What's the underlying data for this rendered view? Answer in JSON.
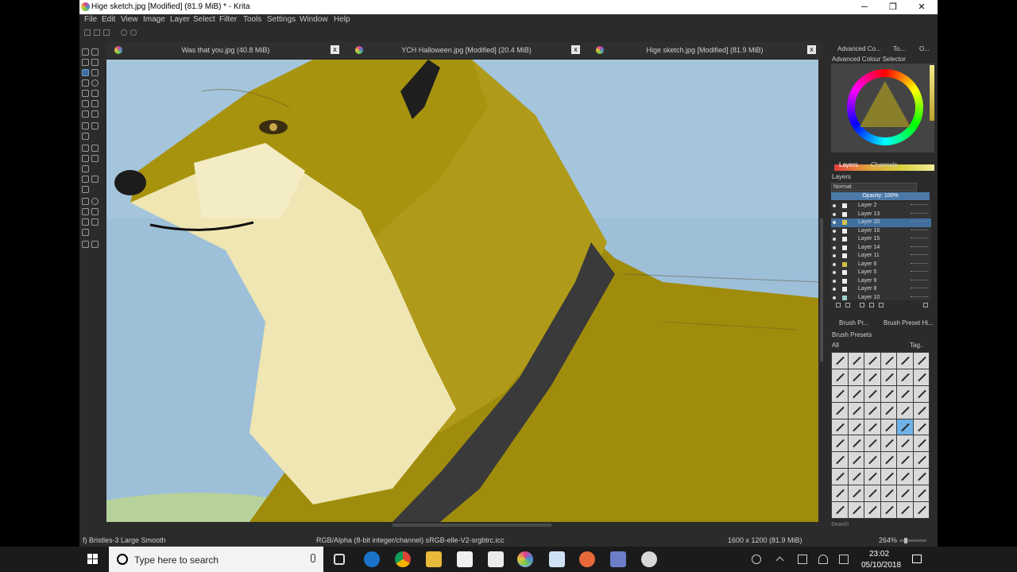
{
  "window": {
    "title": "Hige sketch.jpg [Modified]  (81.9 MiB) * - Krita",
    "buttons": {
      "minimize": "─",
      "maximize": "❐",
      "close": "✕"
    }
  },
  "menu": [
    "File",
    "Edit",
    "View",
    "Image",
    "Layer",
    "Select",
    "Filter",
    "Tools",
    "Settings",
    "Window",
    "Help"
  ],
  "doc_tabs": [
    {
      "label": "Was that you.jpg (40.8 MiB)",
      "close": "x"
    },
    {
      "label": "YCH Halloween.jpg [Modified]  (20.4 MiB)",
      "close": "x"
    },
    {
      "label": "Hige sketch.jpg [Modified]  (81.9 MiB)",
      "close": "x"
    }
  ],
  "dock": {
    "top_tabs": [
      "Advanced Co...",
      "To...",
      "O..."
    ],
    "color_selector_title": "Advanced Colour Selector",
    "layers_tabs": [
      "Layers",
      "Channels"
    ],
    "layers_title": "Layers",
    "blend_mode": "Normal",
    "opacity_label": "Opacity:  100%",
    "layers": [
      "Layer 2",
      "Layer 13",
      "Layer 20",
      "Layer 16",
      "Layer 15",
      "Layer 14",
      "Layer 11",
      "Layer 6",
      "Layer 5",
      "Layer 9",
      "Layer 8",
      "Layer 10"
    ],
    "selected_layer": "Layer 20",
    "brush_tabs": [
      "Brush Pr...",
      "Brush Preset Hi..."
    ],
    "brush_presets_title": "Brush Presets",
    "brush_filter": "All",
    "brush_tag": "Tag..",
    "search_placeholder": "Search"
  },
  "status": {
    "brush": "f) Bristles-3 Large Smooth",
    "color_space": "RGB/Alpha (8-bit integer/channel)  sRGB-elle-V2-srgbtrc.icc",
    "dimensions": "1600 x 1200 (81.9 MiB)",
    "zoom": "264%"
  },
  "taskbar": {
    "search_placeholder": "Type here to search",
    "time": "23:02",
    "date": "05/10/2018"
  },
  "colors": {
    "sky": "#9bbdd5",
    "fur_gold": "#a08c0c",
    "fur_light": "#f1e9b8",
    "collar": "#3c3c3c",
    "accent": "#4b7aa8"
  }
}
